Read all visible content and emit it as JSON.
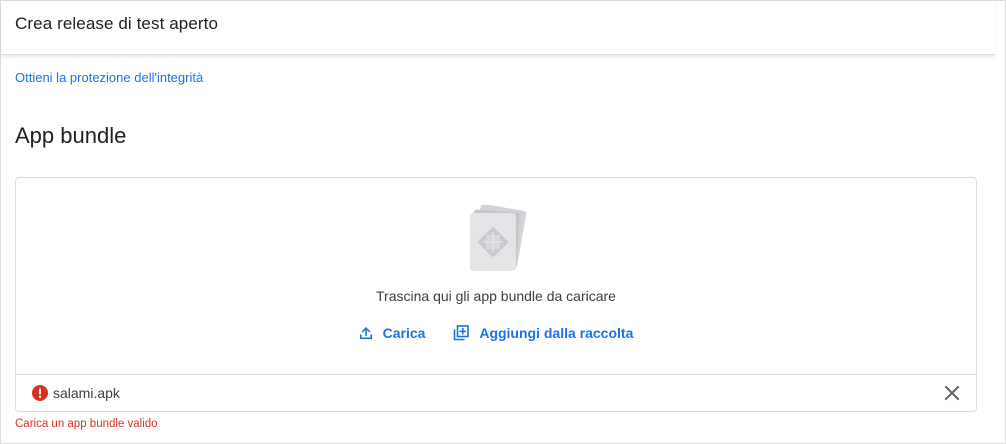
{
  "header": {
    "title": "Crea release di test aperto"
  },
  "integrity_link": "Ottieni la protezione dell'integrità",
  "section": {
    "title": "App bundle"
  },
  "dropzone": {
    "illustration_icon": "app-bundle-icon",
    "instruction": "Trascina qui gli app bundle da caricare",
    "upload_label": "Carica",
    "upload_icon": "upload-icon",
    "library_label": "Aggiungi dalla raccolta",
    "library_icon": "add-to-library-icon"
  },
  "file": {
    "name": "salami.apk",
    "status_icon": "error-icon",
    "remove_icon": "close-icon"
  },
  "error_message": "Carica un app bundle valido",
  "colors": {
    "link": "#1a73e8",
    "error": "#d93025",
    "text": "#202124",
    "border": "#dadce0"
  }
}
